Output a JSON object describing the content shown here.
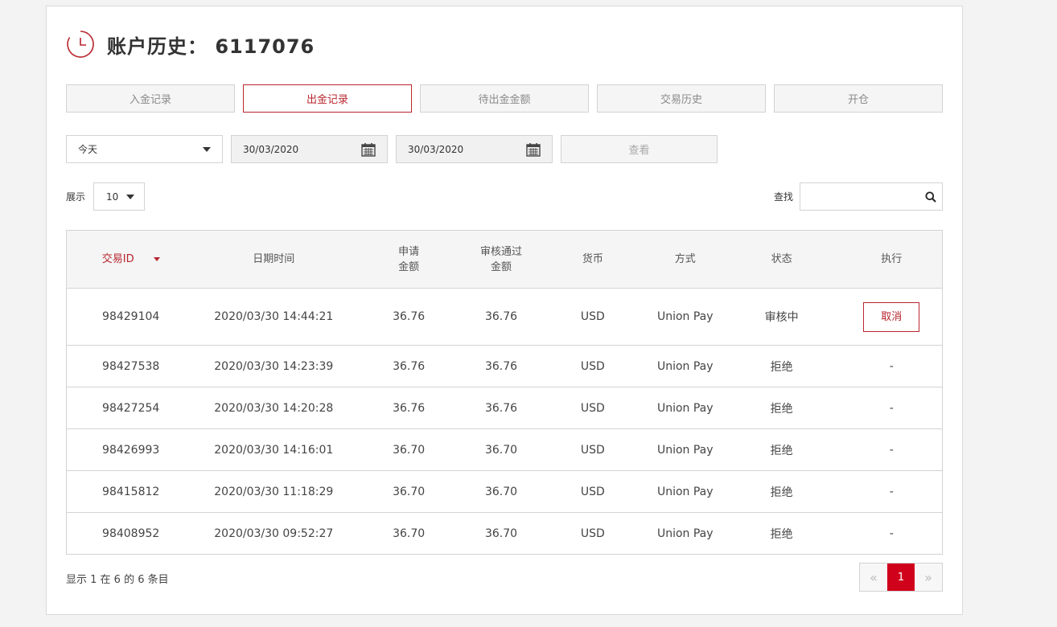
{
  "header": {
    "title": "账户历史： 6117076"
  },
  "tabs": [
    {
      "label": "入金记录",
      "active": false
    },
    {
      "label": "出金记录",
      "active": true
    },
    {
      "label": "待出金金额",
      "active": false
    },
    {
      "label": "交易历史",
      "active": false
    },
    {
      "label": "开仓",
      "active": false
    }
  ],
  "filters": {
    "period": "今天",
    "date_from": "30/03/2020",
    "date_to": "30/03/2020",
    "view_label": "查看"
  },
  "length": {
    "label": "展示",
    "value": "10"
  },
  "search": {
    "label": "查找",
    "value": ""
  },
  "table": {
    "headers": {
      "id": "交易ID",
      "datetime": "日期时间",
      "requested_line1": "申请",
      "requested_line2": "金额",
      "approved_line1": "审核通过",
      "approved_line2": "金额",
      "currency": "货币",
      "method": "方式",
      "status": "状态",
      "action": "执行"
    },
    "rows": [
      {
        "id": "98429104",
        "datetime": "2020/03/30 14:44:21",
        "requested": "36.76",
        "approved": "36.76",
        "currency": "USD",
        "method": "Union Pay",
        "status": "审核中",
        "action": "取消"
      },
      {
        "id": "98427538",
        "datetime": "2020/03/30 14:23:39",
        "requested": "36.76",
        "approved": "36.76",
        "currency": "USD",
        "method": "Union Pay",
        "status": "拒绝",
        "action": "-"
      },
      {
        "id": "98427254",
        "datetime": "2020/03/30 14:20:28",
        "requested": "36.76",
        "approved": "36.76",
        "currency": "USD",
        "method": "Union Pay",
        "status": "拒绝",
        "action": "-"
      },
      {
        "id": "98426993",
        "datetime": "2020/03/30 14:16:01",
        "requested": "36.70",
        "approved": "36.70",
        "currency": "USD",
        "method": "Union Pay",
        "status": "拒绝",
        "action": "-"
      },
      {
        "id": "98415812",
        "datetime": "2020/03/30 11:18:29",
        "requested": "36.70",
        "approved": "36.70",
        "currency": "USD",
        "method": "Union Pay",
        "status": "拒绝",
        "action": "-"
      },
      {
        "id": "98408952",
        "datetime": "2020/03/30 09:52:27",
        "requested": "36.70",
        "approved": "36.70",
        "currency": "USD",
        "method": "Union Pay",
        "status": "拒绝",
        "action": "-"
      }
    ]
  },
  "footer": {
    "info": "显示 1 在 6 的 6 条目",
    "prev": "«",
    "page": "1",
    "next": "»"
  },
  "colors": {
    "accent": "#b7262e",
    "page_active": "#d0021b"
  }
}
